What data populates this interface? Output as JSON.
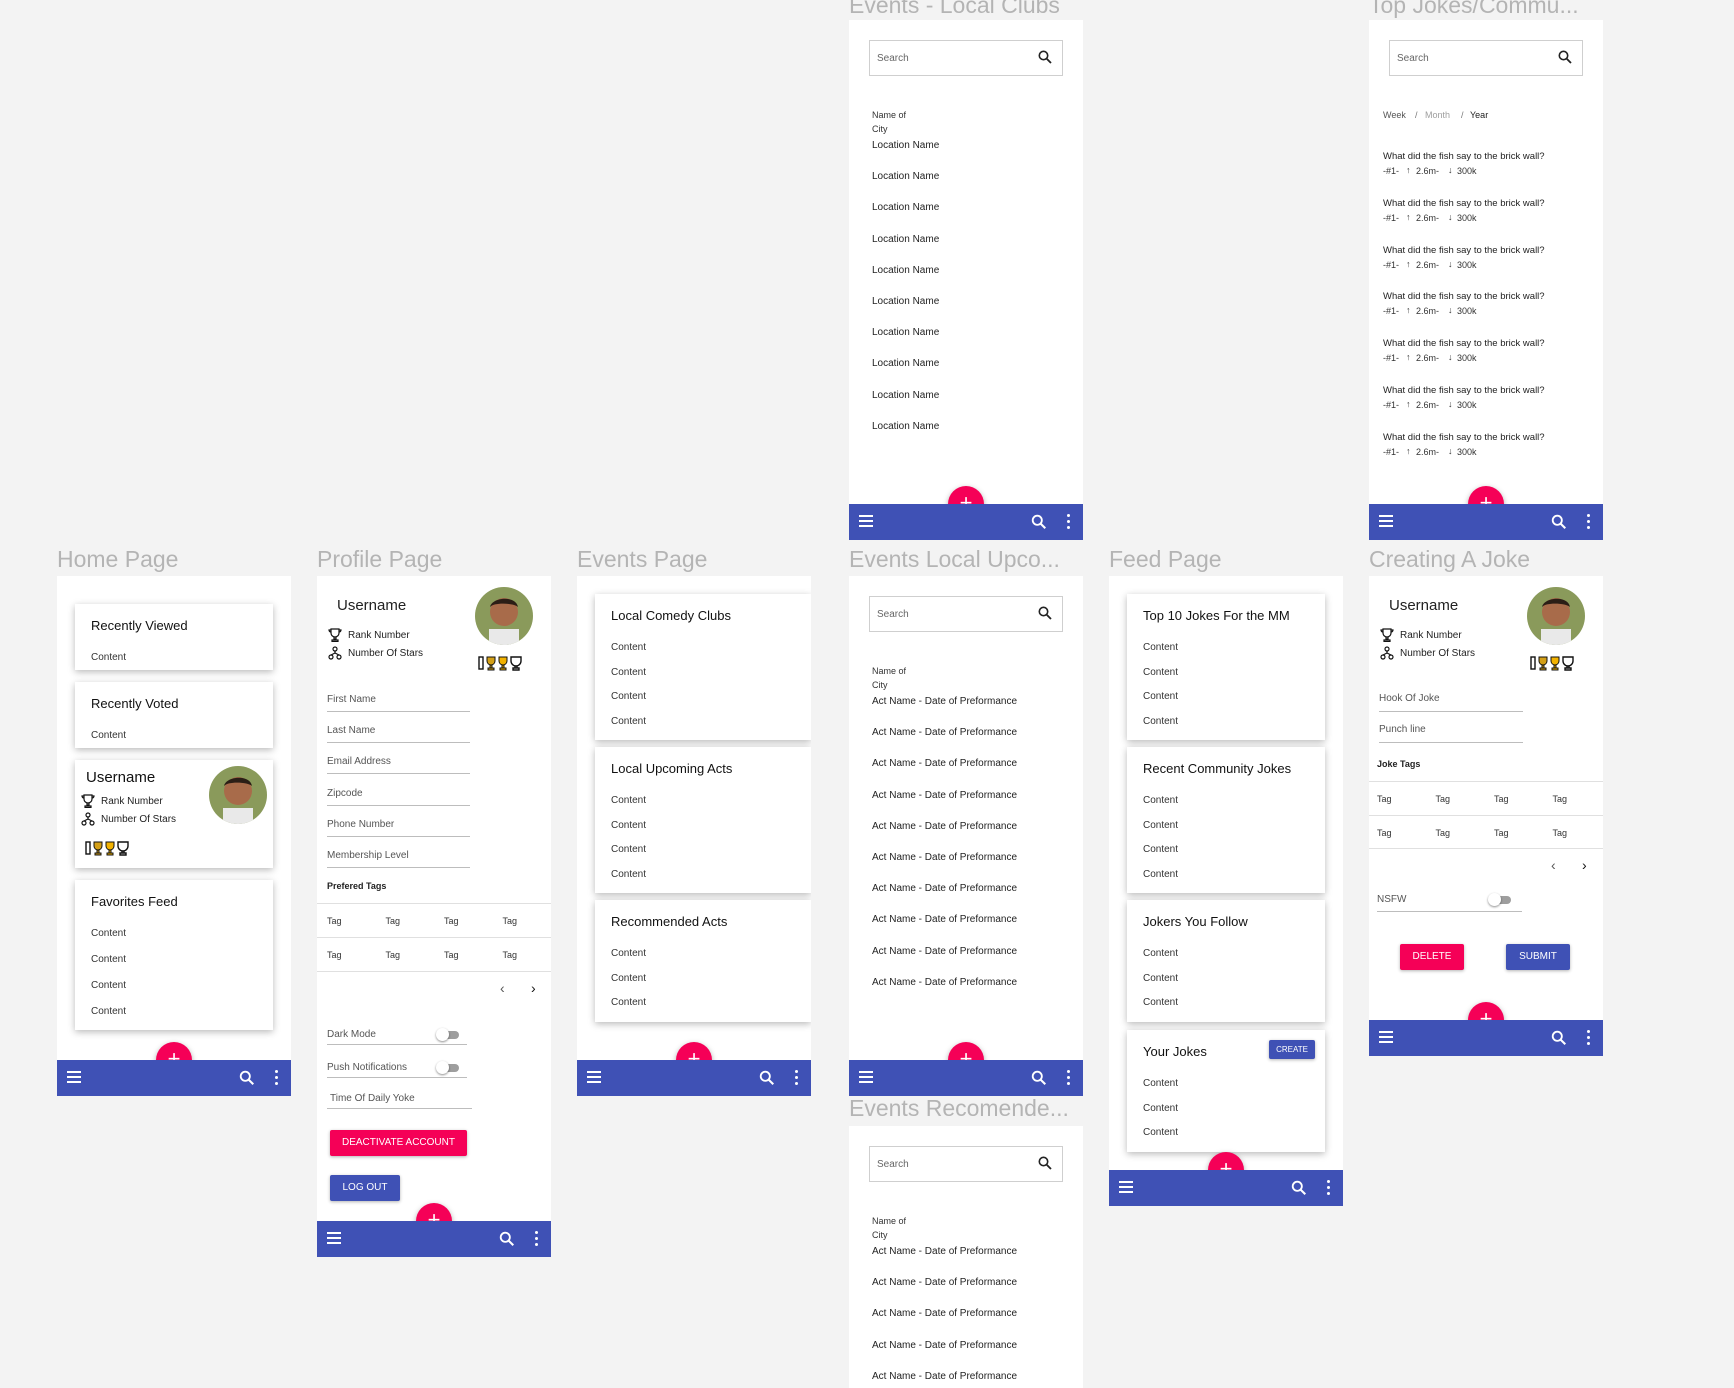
{
  "frame_titles": {
    "local_clubs": "Events - Local Clubs",
    "top_jokes": "Top Jokes/Commu...",
    "home": "Home Page",
    "profile": "Profile Page",
    "events": "Events Page",
    "events_upcoming": "Events Local Upco...",
    "feed": "Feed Page",
    "creating_joke": "Creating A Joke",
    "events_recommended": "Events Recomende..."
  },
  "colors": {
    "primary": "#3f51b5",
    "accent": "#f50057"
  },
  "common": {
    "search_placeholder": "Search",
    "fab": "+",
    "content": "Content",
    "tag": "Tag",
    "name_of": "Name of",
    "city": "City"
  },
  "local_clubs": {
    "locations": [
      "Location Name",
      "Location Name",
      "Location Name",
      "Location Name",
      "Location Name",
      "Location Name",
      "Location Name",
      "Location Name",
      "Location Name",
      "Location Name"
    ]
  },
  "top_jokes": {
    "filters": [
      "Week",
      "Month",
      "Year"
    ],
    "separator": "/",
    "jokes": [
      {
        "text": "What did the fish say to the brick wall?",
        "rank": "-#1-",
        "up": "2.6m-",
        "down": "300k"
      },
      {
        "text": "What did the fish say to the brick wall?",
        "rank": "-#1-",
        "up": "2.6m-",
        "down": "300k"
      },
      {
        "text": "What did the fish say to the brick wall?",
        "rank": "-#1-",
        "up": "2.6m-",
        "down": "300k"
      },
      {
        "text": "What did the fish say to the brick wall?",
        "rank": "-#1-",
        "up": "2.6m-",
        "down": "300k"
      },
      {
        "text": "What did the fish say to the brick wall?",
        "rank": "-#1-",
        "up": "2.6m-",
        "down": "300k"
      },
      {
        "text": "What did the fish say to the brick wall?",
        "rank": "-#1-",
        "up": "2.6m-",
        "down": "300k"
      },
      {
        "text": "What did the fish say to the brick wall?",
        "rank": "-#1-",
        "up": "2.6m-",
        "down": "300k"
      }
    ]
  },
  "home": {
    "recently_viewed": "Recently Viewed",
    "recently_voted": "Recently Voted",
    "username": "Username",
    "rank": "Rank Number",
    "stars": "Number Of Stars",
    "favorites": "Favorites Feed"
  },
  "profile": {
    "username": "Username",
    "rank": "Rank Number",
    "stars": "Number Of Stars",
    "fields": [
      "First Name",
      "Last Name",
      "Email Address",
      "Zipcode",
      "Phone Number",
      "Membership Level"
    ],
    "tags_label": "Prefered Tags",
    "dark_mode": "Dark Mode",
    "push": "Push Notifications",
    "daily": "Time Of Daily Yoke",
    "deactivate": "DEACTIVATE ACCOUNT",
    "logout": "LOG OUT"
  },
  "events": {
    "cards": [
      {
        "title": "Local Comedy Clubs",
        "items": 4
      },
      {
        "title": "Local Upcoming Acts",
        "items": 4
      },
      {
        "title": "Recommended Acts",
        "items": 3
      }
    ]
  },
  "events_upcoming": {
    "acts": [
      "Act Name - Date of Preformance",
      "Act Name - Date of Preformance",
      "Act Name - Date of Preformance",
      "Act Name - Date of Preformance",
      "Act Name - Date of Preformance",
      "Act Name - Date of Preformance",
      "Act Name - Date of Preformance",
      "Act Name - Date of Preformance",
      "Act Name - Date of Preformance",
      "Act Name - Date of Preformance"
    ]
  },
  "events_recommended": {
    "acts": [
      "Act Name - Date of Preformance",
      "Act Name - Date of Preformance",
      "Act Name - Date of Preformance",
      "Act Name - Date of Preformance",
      "Act Name - Date of Preformance"
    ]
  },
  "feed": {
    "cards": [
      {
        "title": "Top 10 Jokes For the MM",
        "items": 4
      },
      {
        "title": "Recent Community Jokes",
        "items": 4
      },
      {
        "title": "Jokers You Follow",
        "items": 3
      },
      {
        "title": "Your Jokes",
        "items": 3
      }
    ],
    "create": "CREATE"
  },
  "creating_joke": {
    "username": "Username",
    "rank": "Rank Number",
    "stars": "Number Of Stars",
    "hook": "Hook Of Joke",
    "punch": "Punch line",
    "tags_label": "Joke Tags",
    "nsfw": "NSFW",
    "delete": "DELETE",
    "submit": "SUBMIT"
  }
}
